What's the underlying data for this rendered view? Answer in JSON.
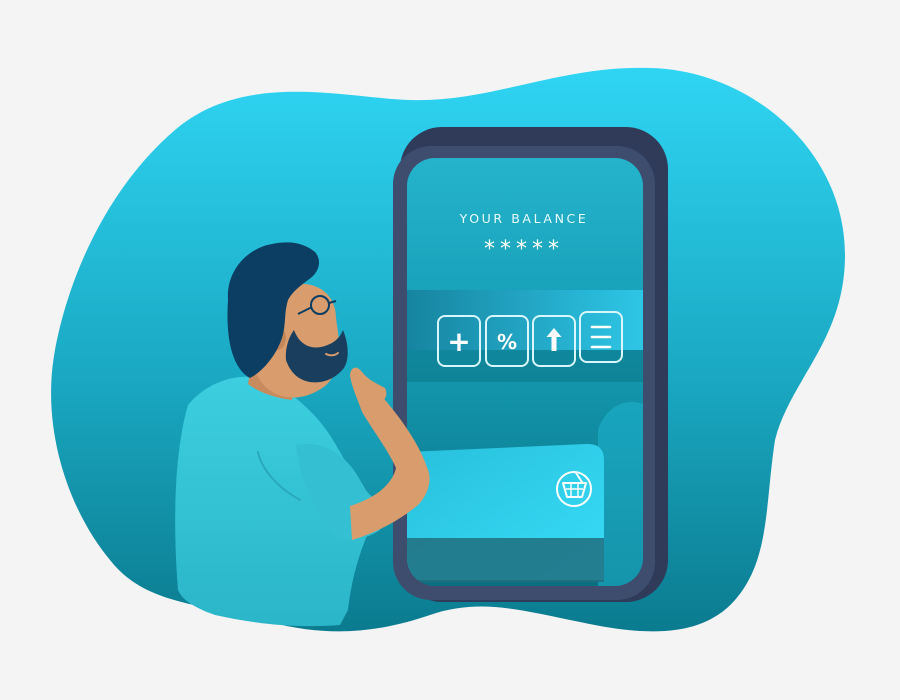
{
  "screen": {
    "balance_label": "YOUR BALANCE",
    "balance_value": "*****"
  },
  "actions": [
    {
      "label": "+",
      "icon": "plus-icon"
    },
    {
      "label": "%",
      "icon": "percent-icon"
    },
    {
      "label": "",
      "icon": "arrow-up-icon"
    },
    {
      "label": "",
      "icon": "menu-icon"
    }
  ],
  "card": {
    "icon": "shopping-basket-icon"
  },
  "colors": {
    "background": "#f4f4f5",
    "blob_top": "#30d4f2",
    "blob_bottom": "#0b7f93",
    "phone_frame": "#3e4d6e",
    "shirt": "#37c6d8",
    "skin": "#d99c6c",
    "hair": "#0c3e63"
  }
}
